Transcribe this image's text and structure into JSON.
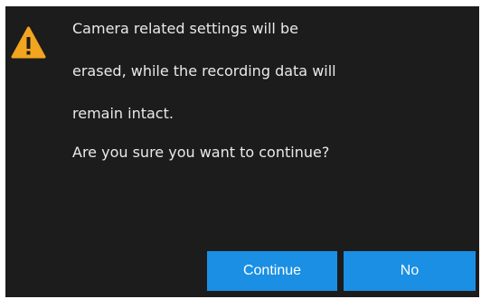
{
  "dialog": {
    "message_lines": [
      "Camera related settings will be",
      "erased, while the recording data will",
      "remain intact.",
      "Are you sure you want to continue?"
    ],
    "buttons": {
      "continue_label": "Continue",
      "no_label": "No"
    },
    "icon": "warning-icon"
  },
  "colors": {
    "dialog_background": "#1c1c1c",
    "text": "#e9e9e9",
    "button": "#1a8fe3",
    "warning": "#f2a51f"
  }
}
